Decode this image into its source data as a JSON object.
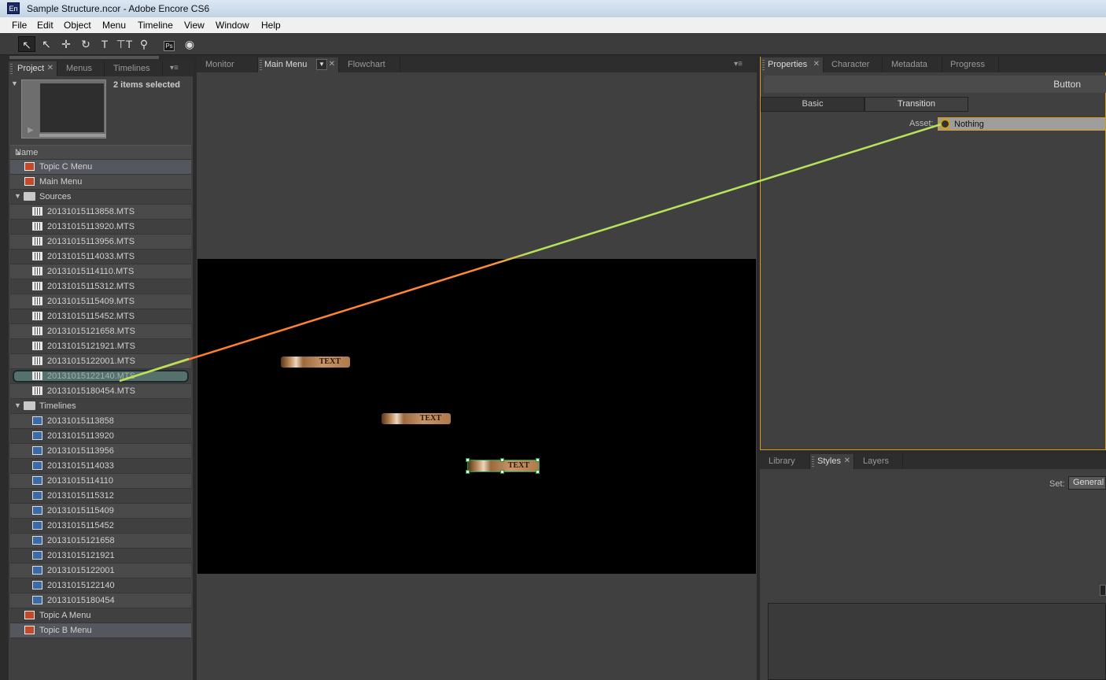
{
  "window": {
    "title": "Sample Structure.ncor - Adobe Encore CS6",
    "app_icon": "En"
  },
  "menubar": [
    "File",
    "Edit",
    "Object",
    "Menu",
    "Timeline",
    "View",
    "Window",
    "Help"
  ],
  "toolbar": {
    "ps_label": "Ps"
  },
  "project_panel": {
    "tabs": [
      "Project",
      "Menus",
      "Timelines"
    ],
    "selection_info": "2 items selected",
    "column_header": "Name",
    "items": [
      "Topic C Menu",
      "Main Menu",
      "Sources",
      "20131015113858.MTS",
      "20131015113920.MTS",
      "20131015113956.MTS",
      "20131015114033.MTS",
      "20131015114110.MTS",
      "20131015115312.MTS",
      "20131015115409.MTS",
      "20131015115452.MTS",
      "20131015121658.MTS",
      "20131015121921.MTS",
      "20131015122001.MTS",
      "20131015122140.MTS",
      "20131015180454.MTS",
      "Timelines",
      "20131015113858",
      "20131015113920",
      "20131015113956",
      "20131015114033",
      "20131015114110",
      "20131015115312",
      "20131015115409",
      "20131015115452",
      "20131015121658",
      "20131015121921",
      "20131015122001",
      "20131015122140",
      "20131015180454",
      "Topic A Menu",
      "Topic B Menu"
    ]
  },
  "monitor_panel": {
    "tabs": [
      "Monitor",
      "Main Menu",
      "Flowchart"
    ],
    "buttons": [
      "TEXT",
      "TEXT",
      "TEXT"
    ]
  },
  "properties_panel": {
    "tabs": [
      "Properties",
      "Character",
      "Metadata",
      "Progress"
    ],
    "header": "Button",
    "subtabs": [
      "Basic",
      "Transition"
    ],
    "asset_label": "Asset:",
    "asset_value": "Nothing"
  },
  "library_panel": {
    "tabs": [
      "Library",
      "Styles",
      "Layers"
    ],
    "set_label": "Set:",
    "set_value": "General"
  },
  "colors": {
    "pickwhip_start": "#ff7a2a",
    "pickwhip_end": "#b6e35a",
    "focus_border": "#d79a1b"
  }
}
